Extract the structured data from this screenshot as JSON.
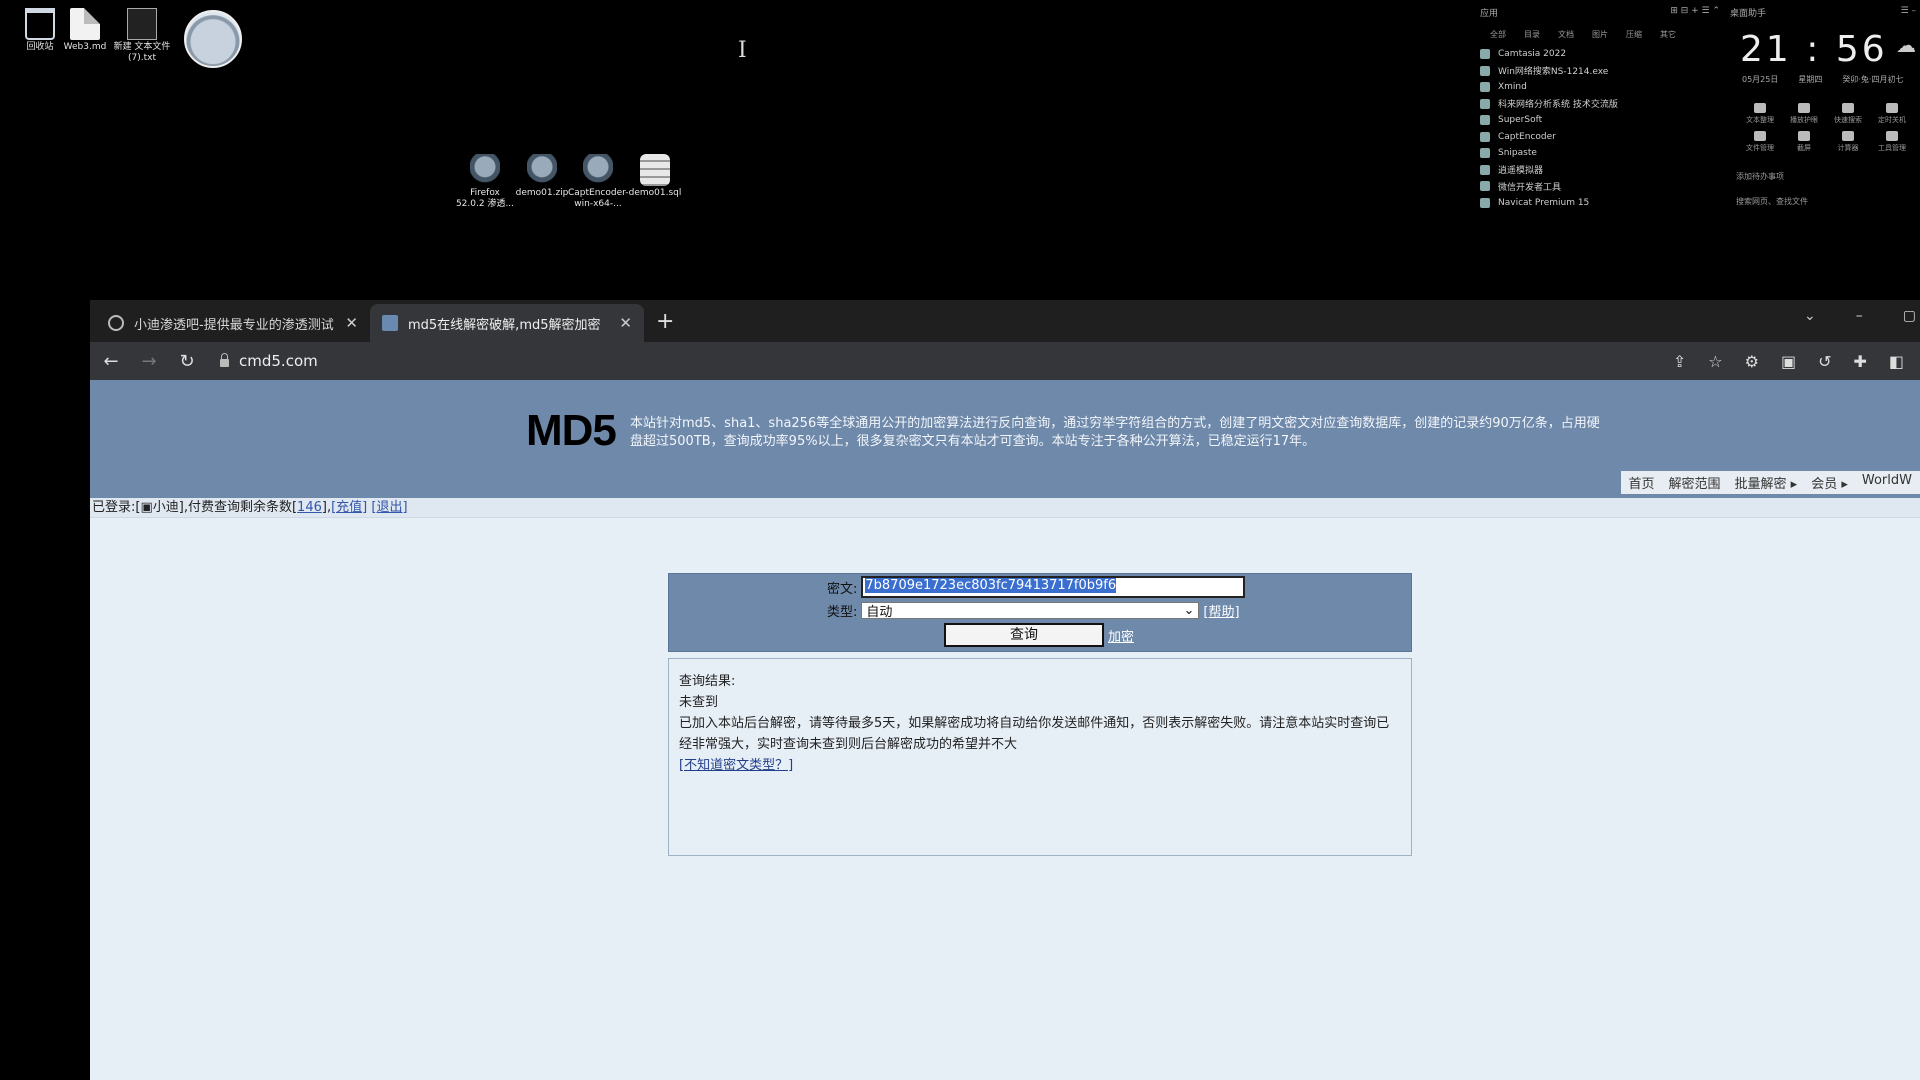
{
  "desktop": {
    "icons": [
      {
        "label": "回收站"
      },
      {
        "label": "Web3.md"
      },
      {
        "label": "新建 文本文件 (7).txt"
      }
    ],
    "icons2": [
      {
        "label": "Firefox 52.0.2 渗透..."
      },
      {
        "label": "demo01.zip"
      },
      {
        "label": "CaptEncoder-win-x64-..."
      },
      {
        "label": "demo01.sql"
      }
    ]
  },
  "apps_panel": {
    "title": "应用",
    "tabs": [
      "全部",
      "目录",
      "文档",
      "图片",
      "压缩",
      "其它"
    ],
    "items": [
      "Camtasia 2022",
      "Win网络搜索NS-1214.exe",
      "Xmind",
      "科来网络分析系统 技术交流版",
      "SuperSoft",
      "CaptEncoder",
      "Snipaste",
      "逍遥模拟器",
      "微信开发者工具",
      "Navicat Premium 15"
    ]
  },
  "clock": {
    "title": "桌面助手",
    "time": "21 : 56",
    "date": "05月25日",
    "weekday": "星期四",
    "lunar": "癸卯·兔·四月初七",
    "tools": [
      "文本整理",
      "播放护眼",
      "快速搜索",
      "定时关机",
      "文件管理",
      "截屏",
      "计算器",
      "工具管理"
    ],
    "footer1": "添加待办事项",
    "footer2": "搜索网页、查找文件"
  },
  "browser": {
    "tabs": [
      {
        "title": "小迪渗透吧-提供最专业的渗透测试",
        "active": false
      },
      {
        "title": "md5在线解密破解,md5解密加密",
        "active": true
      }
    ],
    "new_tab": "+",
    "url": "cmd5.com"
  },
  "site": {
    "logo": "MD5",
    "desc": "本站针对md5、sha1、sha256等全球通用公开的加密算法进行反向查询，通过穷举字符组合的方式，创建了明文密文对应查询数据库，创建的记录约90万亿条，占用硬盘超过500TB，查询成功率95%以上，很多复杂密文只有本站才可查询。本站专注于各种公开算法，已稳定运行17年。",
    "nav": [
      "首页",
      "解密范围",
      "批量解密 ▸",
      "会员 ▸",
      "WorldW"
    ],
    "login_prefix": "已登录:[",
    "login_user": "小迪",
    "login_mid": "],付费查询剩余条数[",
    "login_count": "146",
    "login_suffix": "],",
    "recharge": "[充值]",
    "logout": "[退出]"
  },
  "form": {
    "cipher_label": "密文:",
    "cipher_value": "7b8709e1723ec803fc79413717f0b9f6",
    "type_label": "类型:",
    "type_value": "自动",
    "help": "[帮助]",
    "query_button": "查询",
    "encrypt_link": "加密"
  },
  "result": {
    "title": "查询结果:",
    "status": "未查到",
    "message": "已加入本站后台解密，请等待最多5天，如果解密成功将自动给你发送邮件通知，否则表示解密失败。请注意本站实时查询已经非常强大，实时查询未查到则后台解密成功的希望并不大",
    "link": "[不知道密文类型？]"
  }
}
